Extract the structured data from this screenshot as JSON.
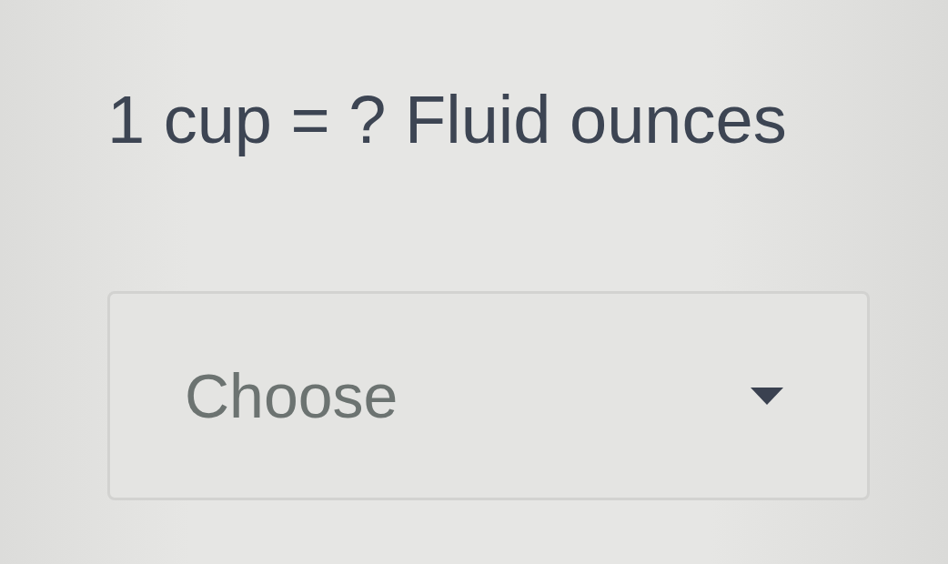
{
  "question": {
    "text": "1 cup = ? Fluid ounces"
  },
  "dropdown": {
    "placeholder": "Choose",
    "expanded": false
  }
}
